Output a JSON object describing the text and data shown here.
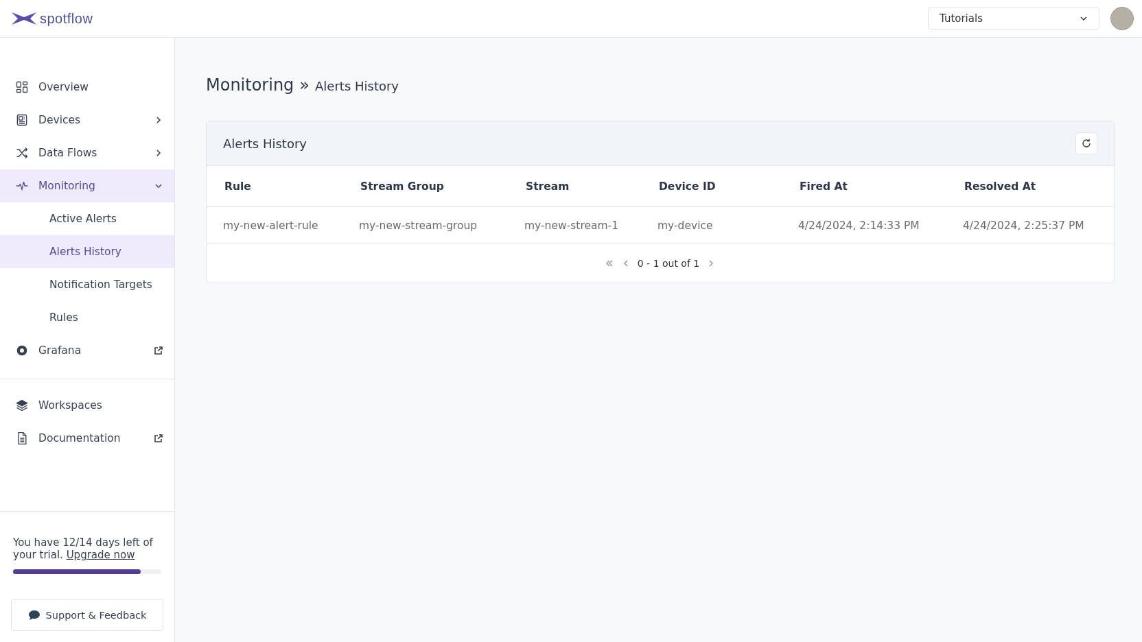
{
  "header": {
    "logo_text": "spotflow",
    "workspace_select": {
      "value": "Tutorials"
    }
  },
  "sidebar": {
    "items": [
      {
        "label": "Overview",
        "kind": "link",
        "selected": false
      },
      {
        "label": "Devices",
        "kind": "expandable",
        "selected": false,
        "expanded": false
      },
      {
        "label": "Data Flows",
        "kind": "expandable",
        "selected": false,
        "expanded": false
      },
      {
        "label": "Monitoring",
        "kind": "expandable",
        "selected": true,
        "expanded": true,
        "children": [
          {
            "label": "Active Alerts",
            "selected": false
          },
          {
            "label": "Alerts History",
            "selected": true
          },
          {
            "label": "Notification Targets",
            "selected": false
          },
          {
            "label": "Rules",
            "selected": false
          }
        ]
      },
      {
        "label": "Grafana",
        "kind": "external",
        "selected": false
      }
    ],
    "secondary_items": [
      {
        "label": "Workspaces",
        "kind": "link",
        "selected": false
      },
      {
        "label": "Documentation",
        "kind": "external",
        "selected": false
      }
    ],
    "trial": {
      "text": "You have 12/14 days left of your trial.",
      "link": "Upgrade now",
      "level": 0.86
    },
    "support_button": "Support & Feedback"
  },
  "breadcrumb": {
    "parent": "Monitoring",
    "separator": "»",
    "current": "Alerts History"
  },
  "card": {
    "title": "Alerts History",
    "table": {
      "columns": [
        "Rule",
        "Stream Group",
        "Stream",
        "Device ID",
        "Fired At",
        "Resolved At"
      ],
      "rows": [
        [
          "my-new-alert-rule",
          "my-new-stream-group",
          "my-new-stream-1",
          "my-device",
          "4/24/2024, 2:14:33 PM",
          "4/24/2024, 2:25:37 PM"
        ]
      ]
    },
    "pagination": {
      "range": "0 - 1 out of 1"
    }
  }
}
